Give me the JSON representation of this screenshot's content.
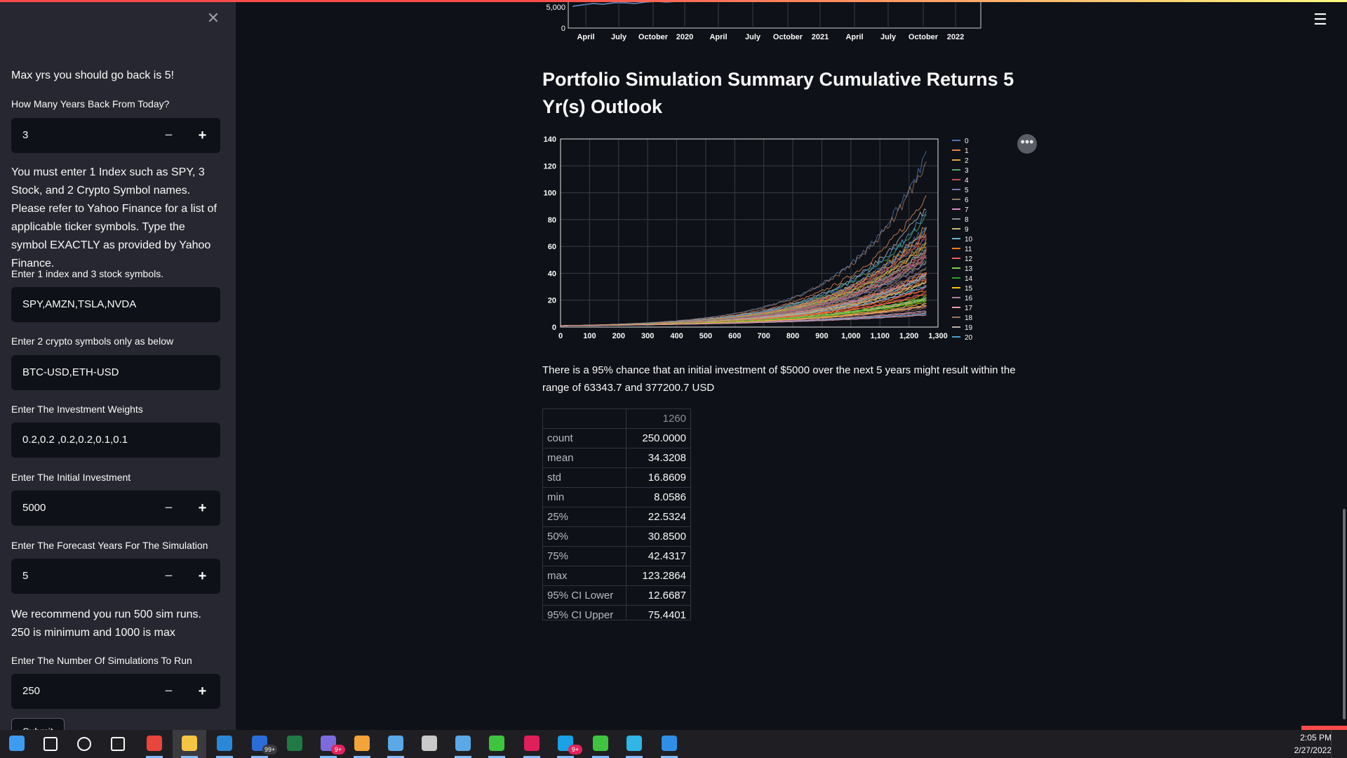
{
  "sidebar": {
    "close_label": "✕",
    "intro": "Max yrs you should go back is 5!",
    "years_label": "How Many Years Back From Today?",
    "years_value": "3",
    "instructions": "You must enter 1 Index such as SPY, 3 Stock, and 2 Crypto Symbol names. Please refer to Yahoo Finance for a list of applicable ticker symbols. Type the symbol EXACTLY as provided by Yahoo Finance.",
    "stocks_label": "Enter 1 index and 3 stock symbols.",
    "stocks_value": "SPY,AMZN,TSLA,NVDA",
    "crypto_label": "Enter 2 crypto symbols only as below",
    "crypto_value": "BTC-USD,ETH-USD",
    "weights_label": "Enter The Investment Weights",
    "weights_value": "0.2,0.2 ,0.2,0.2,0.1,0.1",
    "investment_label": "Enter The Initial Investment",
    "investment_value": "5000",
    "forecast_label": "Enter The Forecast Years For The Simulation",
    "forecast_value": "5",
    "recommend": "We recommend you run 500 sim runs. 250 is minimum and 1000 is max",
    "sims_label": "Enter The Number Of Simulations To Run",
    "sims_value": "250",
    "minus": "−",
    "plus": "+",
    "submit_label": "Submit"
  },
  "main": {
    "top_chart": {
      "y_ticks": [
        "5,000",
        "0"
      ],
      "x_ticks": [
        "April",
        "July",
        "October",
        "2020",
        "April",
        "July",
        "October",
        "2021",
        "April",
        "July",
        "October",
        "2022"
      ]
    },
    "title": "Portfolio Simulation Summary Cumulative Returns 5 Yr(s) Outlook",
    "result_text": "There is a 95% chance that an initial investment of $5000 over the next 5 years might result within the range of 63343.7 and 377200.7 USD",
    "stats_header": "1260",
    "stats_rows": [
      {
        "label": "count",
        "value": "250.0000"
      },
      {
        "label": "mean",
        "value": "34.3208"
      },
      {
        "label": "std",
        "value": "16.8609"
      },
      {
        "label": "min",
        "value": "8.0586"
      },
      {
        "label": "25%",
        "value": "22.5324"
      },
      {
        "label": "50%",
        "value": "30.8500"
      },
      {
        "label": "75%",
        "value": "42.4317"
      },
      {
        "label": "max",
        "value": "123.2864"
      },
      {
        "label": "95% CI Lower",
        "value": "12.6687"
      },
      {
        "label": "95% CI Upper",
        "value": "75.4401"
      }
    ],
    "more_label": "•••"
  },
  "chart_data": {
    "type": "line",
    "title": "",
    "xlabel": "",
    "ylabel": "",
    "xlim": [
      0,
      1300
    ],
    "ylim": [
      0,
      140
    ],
    "x_ticks": [
      "0",
      "100",
      "200",
      "300",
      "400",
      "500",
      "600",
      "700",
      "800",
      "900",
      "1,000",
      "1,100",
      "1,200",
      "1,300"
    ],
    "y_ticks": [
      "0",
      "20",
      "40",
      "60",
      "80",
      "100",
      "120",
      "140"
    ],
    "legend_position": "right",
    "legend_entries": [
      "0",
      "1",
      "2",
      "3",
      "4",
      "5",
      "6",
      "7",
      "8",
      "9",
      "10",
      "11",
      "12",
      "13",
      "14",
      "15",
      "16",
      "17",
      "18",
      "19",
      "20"
    ],
    "series_colors": [
      "#4c72b0",
      "#dd8452",
      "#e8a53a",
      "#55a868",
      "#c44e52",
      "#8172b3",
      "#937860",
      "#da8bc3",
      "#8c8c8c",
      "#ccb974",
      "#64b5cd",
      "#ff7f0e",
      "#f25d5d",
      "#7ad151",
      "#2ca02c",
      "#ffbf00",
      "#b07aa1",
      "#ff9da7",
      "#9c755f",
      "#bab0ac",
      "#4c9bd1"
    ],
    "series_summary": {
      "x_end": 1260,
      "final_values": [
        125,
        90,
        85,
        75,
        70,
        62,
        58,
        52,
        48,
        44,
        40,
        37,
        34,
        31,
        28,
        25,
        22,
        19,
        16,
        12,
        9
      ]
    }
  },
  "taskbar": {
    "time": "2:05 PM",
    "date": "2/27/2022",
    "icons": [
      {
        "name": "windows-start-icon",
        "color": "#3d9bf2"
      },
      {
        "name": "search-icon",
        "color": "#fafafa"
      },
      {
        "name": "cortana-icon",
        "color": "#fafafa"
      },
      {
        "name": "task-view-icon",
        "color": "#fafafa"
      },
      {
        "name": "chrome-icon",
        "color": "#e8453c"
      },
      {
        "name": "file-explorer-icon",
        "color": "#f4c542"
      },
      {
        "name": "store-icon",
        "color": "#2b88d8"
      },
      {
        "name": "mail-icon",
        "color": "#2b6cd8",
        "badge": "99+"
      },
      {
        "name": "excel-icon",
        "color": "#1f7a43"
      },
      {
        "name": "discord-icon",
        "color": "#7b6bdc",
        "badge": "9+"
      },
      {
        "name": "rocket-league-icon",
        "color": "#f2a33a"
      },
      {
        "name": "steam-icon",
        "color": "#5aa8e6"
      },
      {
        "name": "world-of-tanks-icon",
        "color": "#c9c9c9"
      },
      {
        "name": "steam-icon-2",
        "color": "#5aa8e6"
      },
      {
        "name": "razer-icon",
        "color": "#3ec43e"
      },
      {
        "name": "slack-icon",
        "color": "#e01e5a"
      },
      {
        "name": "skype-icon",
        "color": "#1aa1e6",
        "badge": "9+"
      },
      {
        "name": "razer-icon-2",
        "color": "#3ec43e"
      },
      {
        "name": "edge-icon",
        "color": "#2fb5e6"
      },
      {
        "name": "vscode-icon",
        "color": "#2f8fe6"
      }
    ]
  }
}
